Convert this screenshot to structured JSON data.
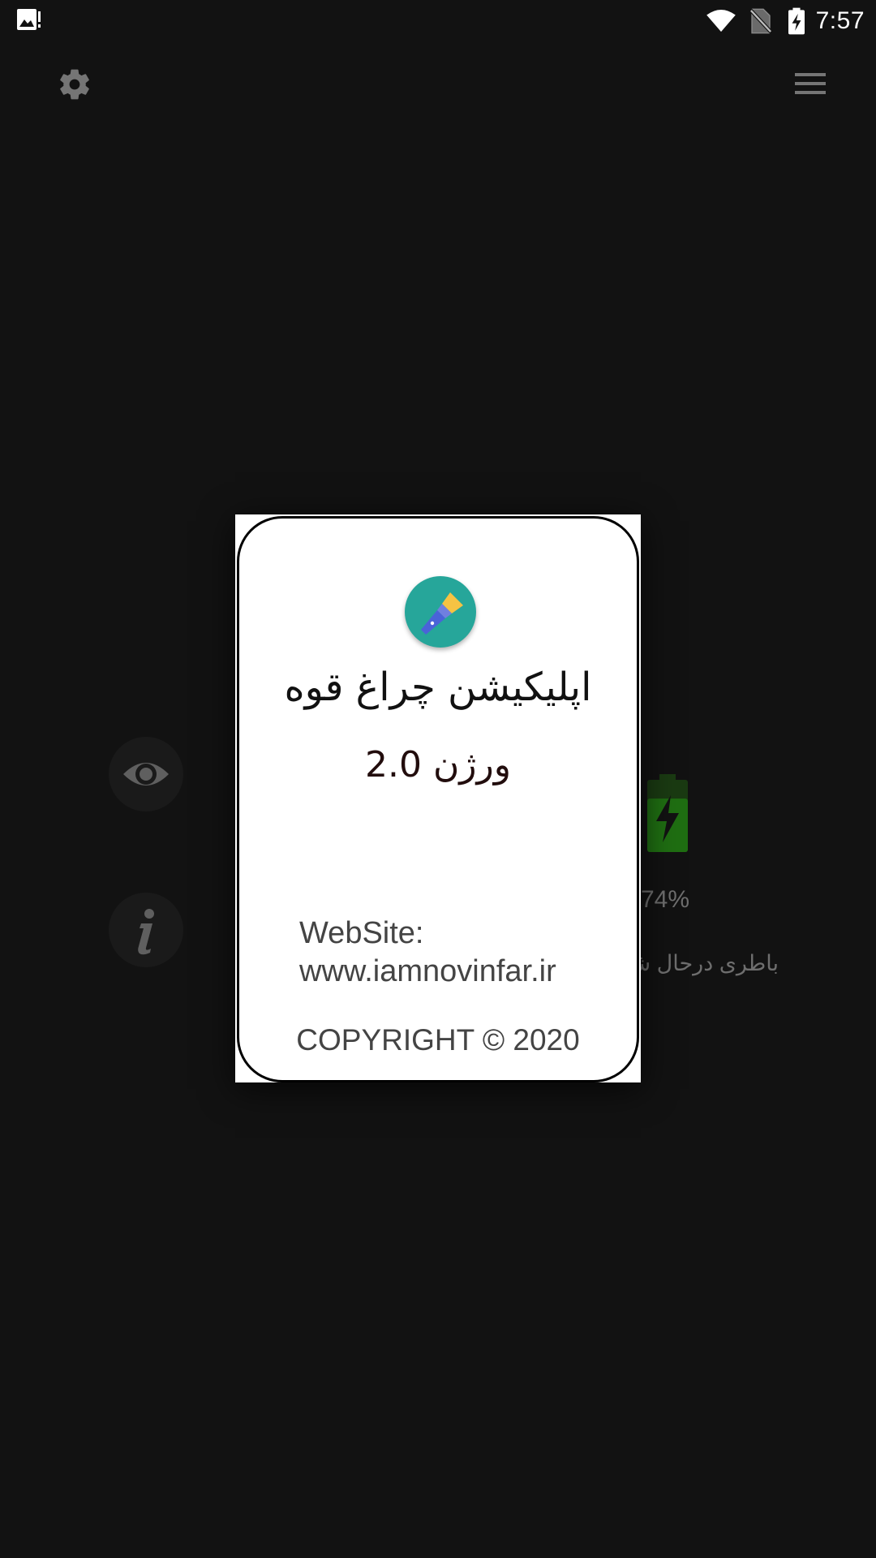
{
  "status_bar": {
    "time": "7:57",
    "icons": [
      "gallery-notification-icon",
      "wifi-icon",
      "no-sim-icon",
      "battery-charging-icon"
    ]
  },
  "toolbar": {
    "settings_icon": "gear-icon",
    "menu_icon": "hamburger-menu-icon"
  },
  "controls": {
    "eye_icon": "eye-icon",
    "info_icon": "info-icon"
  },
  "battery": {
    "level_percent": 74,
    "percent_text": "74%",
    "status_text": "باطری درحال شارژ",
    "color": "#1f6e12"
  },
  "about_dialog": {
    "logo_icon": "flashlight-icon",
    "logo_color": "#26a69a",
    "title": "اپلیکیشن چراغ قوه",
    "version": "ورژن 2.0",
    "website_label": "WebSite:",
    "website_url": "www.iamnovinfar.ir",
    "copyright": "COPYRIGHT © 2020"
  }
}
